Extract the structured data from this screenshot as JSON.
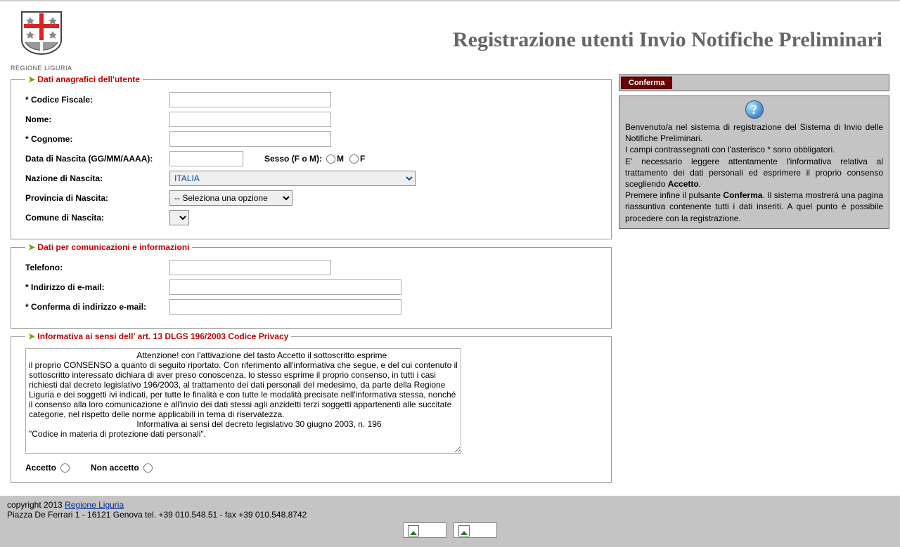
{
  "header": {
    "logo_label": "REGIONE LIGURIA",
    "title": "Registrazione utenti Invio Notifiche Preliminari"
  },
  "anagrafica": {
    "legend": "Dati anagrafici dell'utente",
    "codice_fiscale_label": "* Codice Fiscale:",
    "codice_fiscale_value": "",
    "nome_label": "Nome:",
    "nome_value": "",
    "cognome_label": "* Cognome:",
    "cognome_value": "",
    "data_nascita_label": "Data di Nascita (GG/MM/AAAA):",
    "data_nascita_value": "",
    "sesso_label": "Sesso (F o M):",
    "sesso_m": "M",
    "sesso_f": "F",
    "nazione_label": "Nazione di Nascita:",
    "nazione_value": "ITALIA",
    "provincia_label": "Provincia di Nascita:",
    "provincia_value": "-- Seleziona una opzione",
    "comune_label": "Comune di Nascita:",
    "comune_value": ""
  },
  "comunicazioni": {
    "legend": "Dati per comunicazioni e informazioni",
    "telefono_label": "Telefono:",
    "telefono_value": "",
    "email_label": "* Indirizzo di e-mail:",
    "email_value": "",
    "email_conf_label": "* Conferma di indirizzo e-mail:",
    "email_conf_value": ""
  },
  "privacy": {
    "legend": "Informativa ai sensi dell' art. 13 DLGS 196/2003 Codice Privacy",
    "text": "                                              Attenzione! con l'attivazione del tasto Accetto il sottoscritto esprime\nil proprio CONSENSO a quanto di seguito riportato. Con riferimento all'informativa che segue, e del cui contenuto il sottoscritto interessato dichiara di aver preso conoscenza, lo stesso esprime il proprio consenso, in tutti i casi richiesti dal decreto legislativo 196/2003, al trattamento dei dati personali del medesimo, da parte della Regione Liguria e dei soggetti ivi indicati, per tutte le finalità e con tutte le modalità precisate nell'informativa stessa, nonché il consenso alla loro comunicazione e all'invio dei dati stessi agli anzidetti terzi soggetti appartenenti alle succitate categorie, nel rispetto delle norme applicabili in tema di riservatezza.\n                                              Informativa ai sensi del decreto legislativo 30 giugno 2003, n. 196\n\"Codice in materia di protezione dati personali\".",
    "accetto_label": "Accetto",
    "non_accetto_label": "Non accetto"
  },
  "sidebar": {
    "conferma_label": "Conferma",
    "welcome": "Benvenuto/a nel sistema di registrazione del Sistema di Invio delle Notifiche Preliminari.",
    "mandatory": "I campi contrassegnati con l'asterisco * sono obbligatori.",
    "info_pre": "E' necessario leggere attentamente l'informativa relativa al trattamento dei dati personali ed esprimere il proprio consenso scegliendo ",
    "info_accetto": "Accetto",
    "info_post": ".",
    "press_pre": "Premere infine il pulsante ",
    "press_conferma": "Conferma",
    "press_post": ". Il sistema mostrerà una pagina riassuntiva contenente tutti i dati inseriti. A quel punto è possibile procedere con la registrazione."
  },
  "footer": {
    "copyright_pre": "copyright 2013 ",
    "link_label": "Regione Liguria",
    "address": "Piazza De Ferrari 1 - 16121 Genova tel. +39 010.548.51 - fax +39 010.548.8742"
  }
}
